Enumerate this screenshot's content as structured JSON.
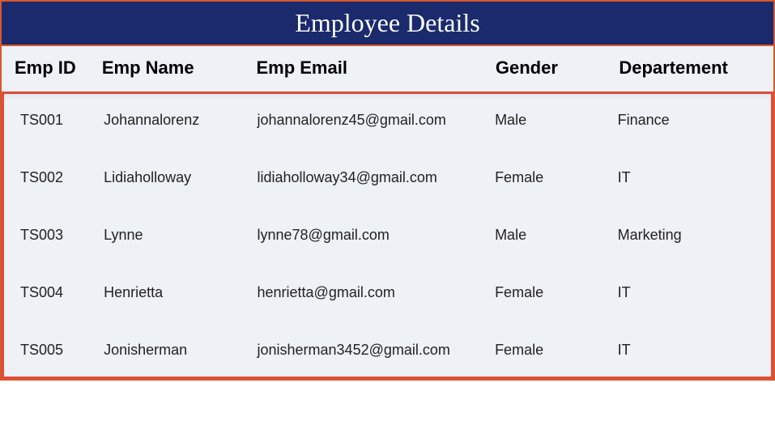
{
  "title": "Employee Details",
  "columns": [
    "Emp ID",
    "Emp Name",
    "Emp Email",
    "Gender",
    "Departement"
  ],
  "rows": [
    {
      "id": "TS001",
      "name": "Johannalorenz",
      "email": "johannalorenz45@gmail.com",
      "gender": "Male",
      "dept": "Finance"
    },
    {
      "id": "TS002",
      "name": "Lidiaholloway",
      "email": "lidiaholloway34@gmail.com",
      "gender": "Female",
      "dept": "IT"
    },
    {
      "id": "TS003",
      "name": "Lynne",
      "email": "lynne78@gmail.com",
      "gender": "Male",
      "dept": "Marketing"
    },
    {
      "id": "TS004",
      "name": "Henrietta",
      "email": "henrietta@gmail.com",
      "gender": "Female",
      "dept": "IT"
    },
    {
      "id": "TS005",
      "name": "Jonisherman",
      "email": "jonisherman3452@gmail.com",
      "gender": "Female",
      "dept": "IT"
    }
  ]
}
